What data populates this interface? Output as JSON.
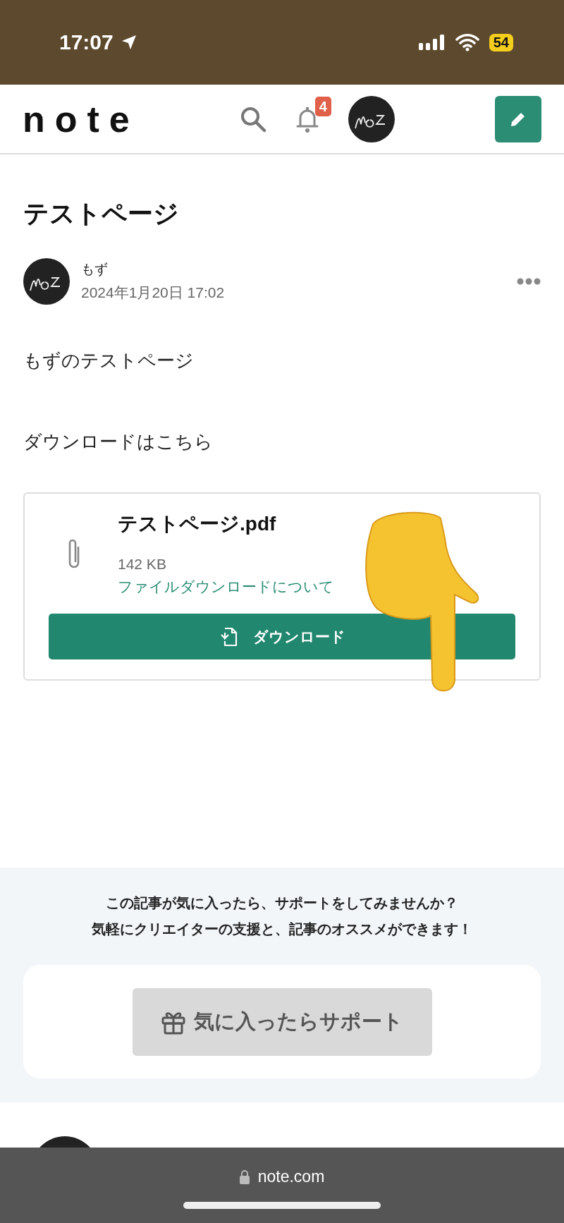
{
  "status_bar": {
    "time": "17:07",
    "battery": "54"
  },
  "header": {
    "logo": "note",
    "notification_count": "4"
  },
  "article": {
    "title": "テストページ",
    "author": "もず",
    "date": "2024年1月20日 17:02",
    "paragraphs": [
      "もずのテストページ",
      "ダウンロードはこちら"
    ],
    "file": {
      "name": "テストページ.pdf",
      "size": "142 KB",
      "link": "ファイルダウンロードについて",
      "button": "ダウンロード"
    }
  },
  "support": {
    "lines": [
      "この記事が気に入ったら、サポートをしてみませんか？",
      "気軽にクリエイターの支援と、記事のオススメができます！"
    ],
    "button": "気に入ったらサポート"
  },
  "browser_bar": {
    "url": "note.com"
  }
}
